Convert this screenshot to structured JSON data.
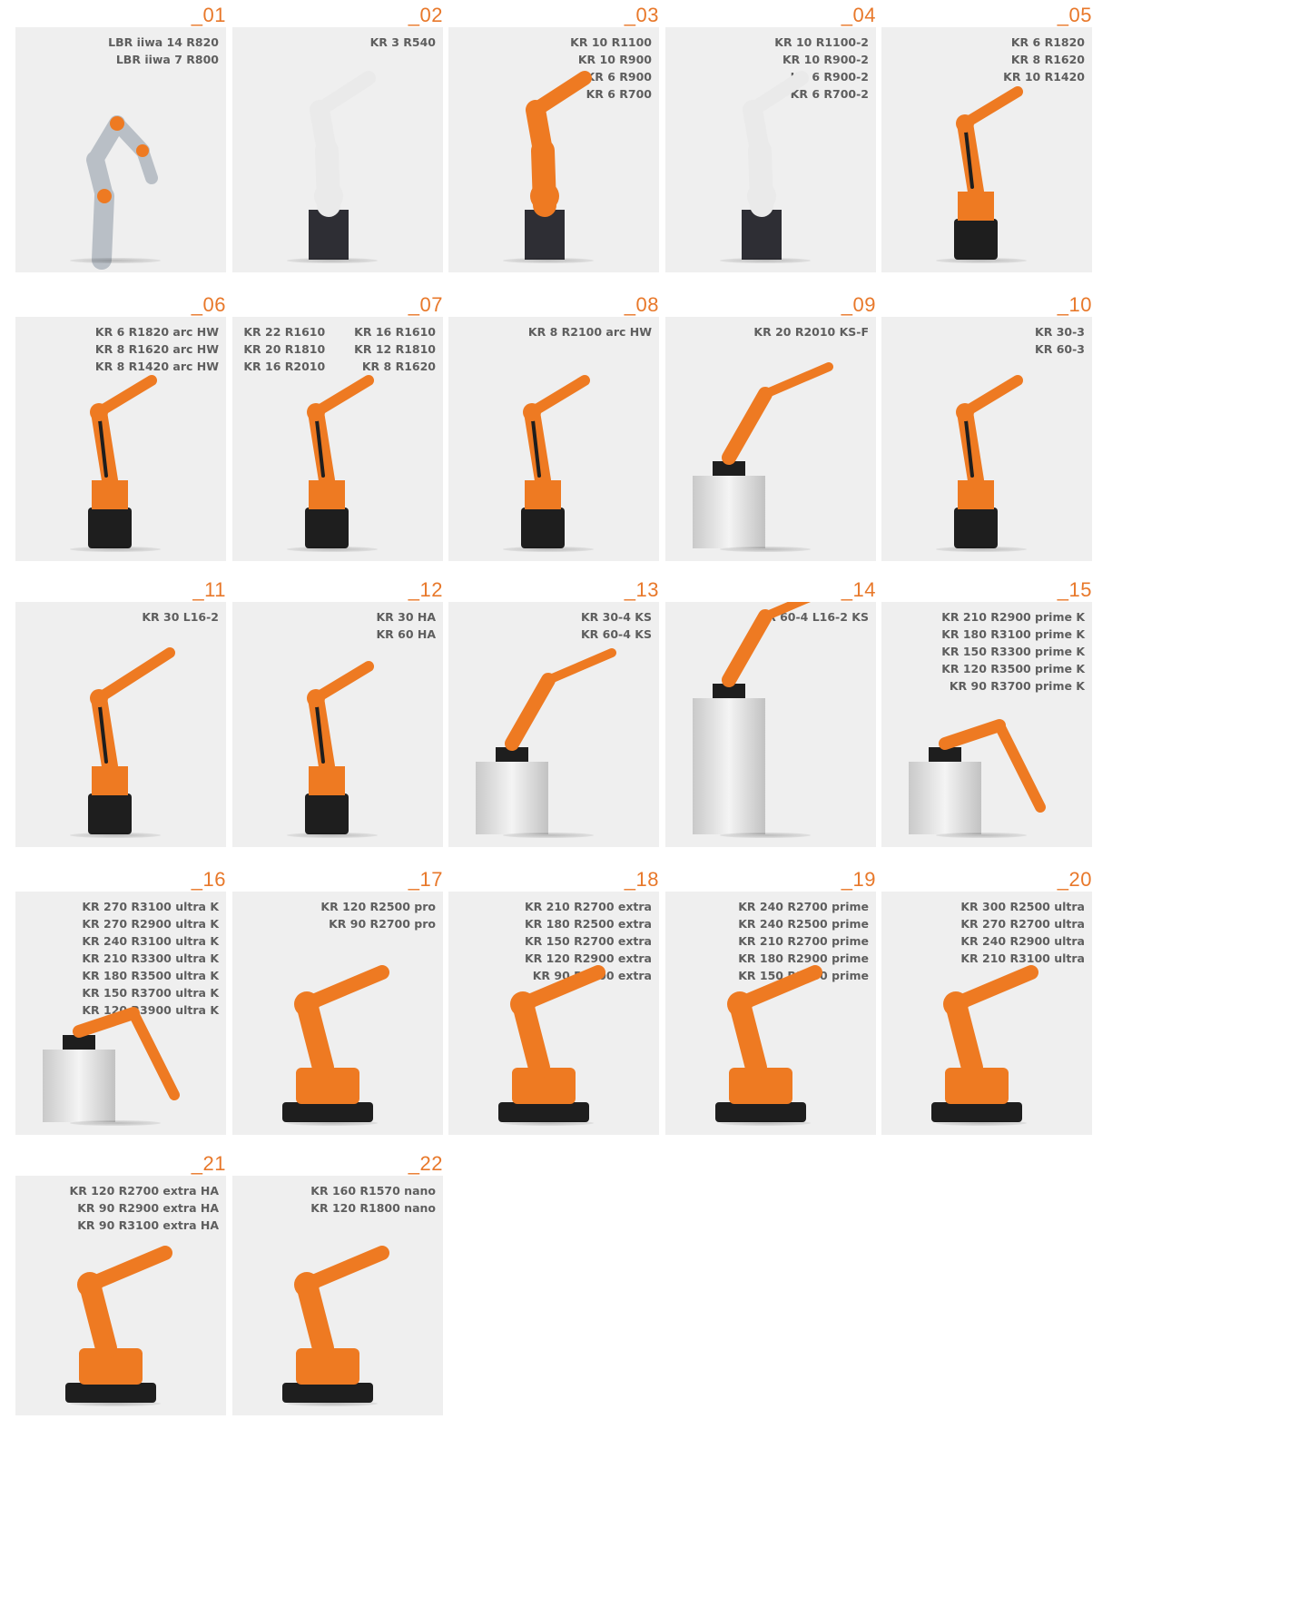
{
  "colors": {
    "accent": "#e8782a",
    "card_bg": "#efefef",
    "text": "#5e5e5e",
    "robot_orange": "#ee7a22",
    "robot_dark": "#1e1e1e",
    "robot_white": "#eaeaea",
    "robot_silver": "#b9bfc6"
  },
  "robots": [
    {
      "number": "_01",
      "models": [
        "LBR iiwa 14 R820",
        "LBR iiwa 7 R800"
      ],
      "kind": "iiwa"
    },
    {
      "number": "_02",
      "models": [
        "KR 3 R540"
      ],
      "kind": "small-white"
    },
    {
      "number": "_03",
      "models": [
        "KR 10 R1100",
        "KR 10 R900",
        "KR 6 R900",
        "KR 6 R700"
      ],
      "kind": "small-orange"
    },
    {
      "number": "_04",
      "models": [
        "KR 10 R1100-2",
        "KR 10 R900-2",
        "KR 6 R900-2",
        "KR 6 R700-2"
      ],
      "kind": "small-white"
    },
    {
      "number": "_05",
      "models": [
        "KR 6 R1820",
        "KR 8 R1620",
        "KR 10 R1420"
      ],
      "kind": "arc"
    },
    {
      "number": "_06",
      "models": [
        "KR 6 R1820 arc HW",
        "KR 8 R1620 arc HW",
        "KR 8 R1420 arc HW"
      ],
      "kind": "arc"
    },
    {
      "number": "_07",
      "models_left": [
        "KR 22 R1610",
        "KR 20 R1810",
        "KR 16 R2010"
      ],
      "models": [
        "KR 16 R1610",
        "KR 12 R1810",
        "KR 8 R1620"
      ],
      "kind": "medium"
    },
    {
      "number": "_08",
      "models": [
        "KR 8 R2100 arc HW"
      ],
      "kind": "arc"
    },
    {
      "number": "_09",
      "models": [
        "KR 20 R2010 KS-F"
      ],
      "kind": "shelf"
    },
    {
      "number": "_10",
      "models": [
        "KR 30-3",
        "KR 60-3"
      ],
      "kind": "medium"
    },
    {
      "number": "_11",
      "models": [
        "KR 30 L16-2"
      ],
      "kind": "long"
    },
    {
      "number": "_12",
      "models": [
        "KR 30 HA",
        "KR 60 HA"
      ],
      "kind": "medium"
    },
    {
      "number": "_13",
      "models": [
        "KR 30-4 KS",
        "KR 60-4 KS"
      ],
      "kind": "shelf"
    },
    {
      "number": "_14",
      "models": [
        "KR 60-4 L16-2 KS"
      ],
      "kind": "tall-shelf"
    },
    {
      "number": "_15",
      "models": [
        "KR 210 R2900 prime K",
        "KR 180 R3100 prime K",
        "KR 150 R3300 prime K",
        "KR 120 R3500 prime K",
        "KR 90 R3700 prime K"
      ],
      "kind": "shelf-down"
    },
    {
      "number": "_16",
      "models": [
        "KR 270 R3100 ultra K",
        "KR 270 R2900 ultra K",
        "KR 240 R3100 ultra K",
        "KR 210 R3300 ultra K",
        "KR 180 R3500 ultra K",
        "KR 150 R3700 ultra K",
        "KR 120 R3900 ultra K"
      ],
      "kind": "shelf-down"
    },
    {
      "number": "_17",
      "models": [
        "KR 120 R2500 pro",
        "KR 90 R2700 pro"
      ],
      "kind": "heavy"
    },
    {
      "number": "_18",
      "models": [
        "KR 210 R2700 extra",
        "KR 180 R2500 extra",
        "KR 150 R2700 extra",
        "KR 120 R2900 extra",
        "KR 90 R3100 extra"
      ],
      "kind": "heavy"
    },
    {
      "number": "_19",
      "models": [
        "KR 240 R2700 prime",
        "KR 240 R2500 prime",
        "KR 210 R2700 prime",
        "KR 180 R2900 prime",
        "KR 150 R3100 prime"
      ],
      "kind": "heavy"
    },
    {
      "number": "_20",
      "models": [
        "KR 300 R2500 ultra",
        "KR 270 R2700 ultra",
        "KR 240 R2900 ultra",
        "KR 210 R3100 ultra"
      ],
      "kind": "heavy"
    },
    {
      "number": "_21",
      "models": [
        "KR 120 R2700 extra HA",
        "KR 90 R2900 extra HA",
        "KR 90 R3100 extra HA"
      ],
      "kind": "heavy"
    },
    {
      "number": "_22",
      "models": [
        "KR 160 R1570 nano",
        "KR 120 R1800 nano"
      ],
      "kind": "heavy"
    }
  ]
}
